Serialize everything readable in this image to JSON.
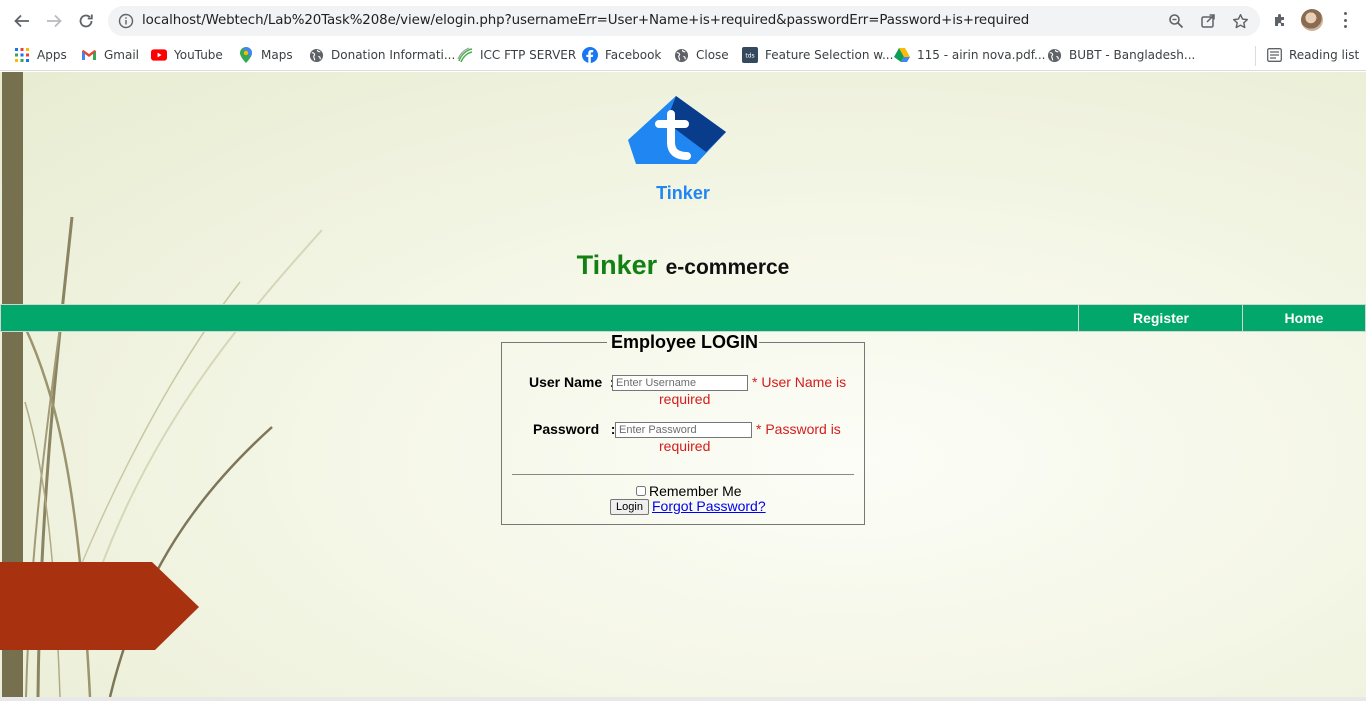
{
  "browser": {
    "url": "localhost/Webtech/Lab%20Task%208e/view/elogin.php?usernameErr=User+Name+is+required&passwordErr=Password+is+required",
    "bookmarks": [
      {
        "label": "Apps",
        "icon": "apps-grid-icon"
      },
      {
        "label": "Gmail",
        "icon": "gmail-icon"
      },
      {
        "label": "YouTube",
        "icon": "youtube-icon"
      },
      {
        "label": "Maps",
        "icon": "maps-icon"
      },
      {
        "label": "Donation Informati...",
        "icon": "globe-icon"
      },
      {
        "label": "ICC FTP SERVER",
        "icon": "icc-icon"
      },
      {
        "label": "Facebook",
        "icon": "facebook-icon"
      },
      {
        "label": "Close",
        "icon": "globe-icon"
      },
      {
        "label": "Feature Selection w...",
        "icon": "tds-icon"
      },
      {
        "label": "115 - airin nova.pdf...",
        "icon": "drive-icon"
      },
      {
        "label": "BUBT - Bangladesh...",
        "icon": "globe-icon"
      }
    ],
    "reading_list": "Reading list"
  },
  "header": {
    "logo_text": "Tinker",
    "brand": "Tinker",
    "tagline": "e-commerce"
  },
  "nav": {
    "register": "Register",
    "home": "Home"
  },
  "login": {
    "legend": "Employee LOGIN",
    "username_label": "User Name  :",
    "username_placeholder": "Enter Username",
    "username_error_line1": "* User Name is",
    "username_error_line2": "required",
    "password_label": "Password   :",
    "password_placeholder": "Enter Password",
    "password_error_line1": "* Password is",
    "password_error_line2": "required",
    "remember_label": "Remember Me",
    "login_button": "Login",
    "forgot_link": "Forgot Password?"
  },
  "colors": {
    "nav_green": "#02a86b",
    "brand_green": "#128012",
    "error_red": "#d61c1c",
    "logo_blue_dark": "#0a3c8c",
    "logo_blue_light": "#1f86f2",
    "arrow_red": "#a83210"
  }
}
